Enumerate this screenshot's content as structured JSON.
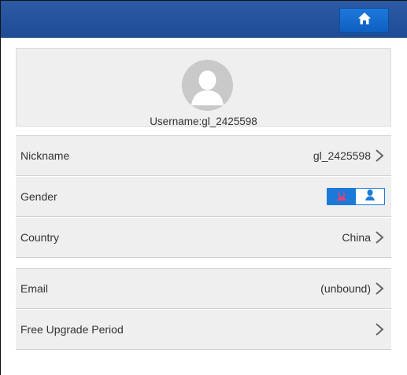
{
  "header": {
    "home_icon": "home-icon",
    "accent": "#1e4c96"
  },
  "profile": {
    "avatar_icon": "default-user-avatar",
    "username": "Username:gl_2425598"
  },
  "account_group": {
    "rows": [
      {
        "label": "Nickname",
        "value": "gl_2425598",
        "icon": "chevron-right-icon"
      },
      {
        "label": "Gender",
        "female_icon": "female-icon",
        "male_icon": "male-icon",
        "selected": "female"
      },
      {
        "label": "Country",
        "value": "China",
        "icon": "chevron-right-icon"
      }
    ]
  },
  "contact_group": {
    "rows": [
      {
        "label": "Email",
        "value": "(unbound)",
        "icon": "chevron-right-icon"
      },
      {
        "label": "Free Upgrade Period",
        "value": "",
        "icon": "chevron-right-icon"
      }
    ]
  },
  "colors": {
    "toggle_active": "#1b7ad8",
    "female_icon": "#e0407a",
    "male_icon": "#1b7ad8"
  }
}
